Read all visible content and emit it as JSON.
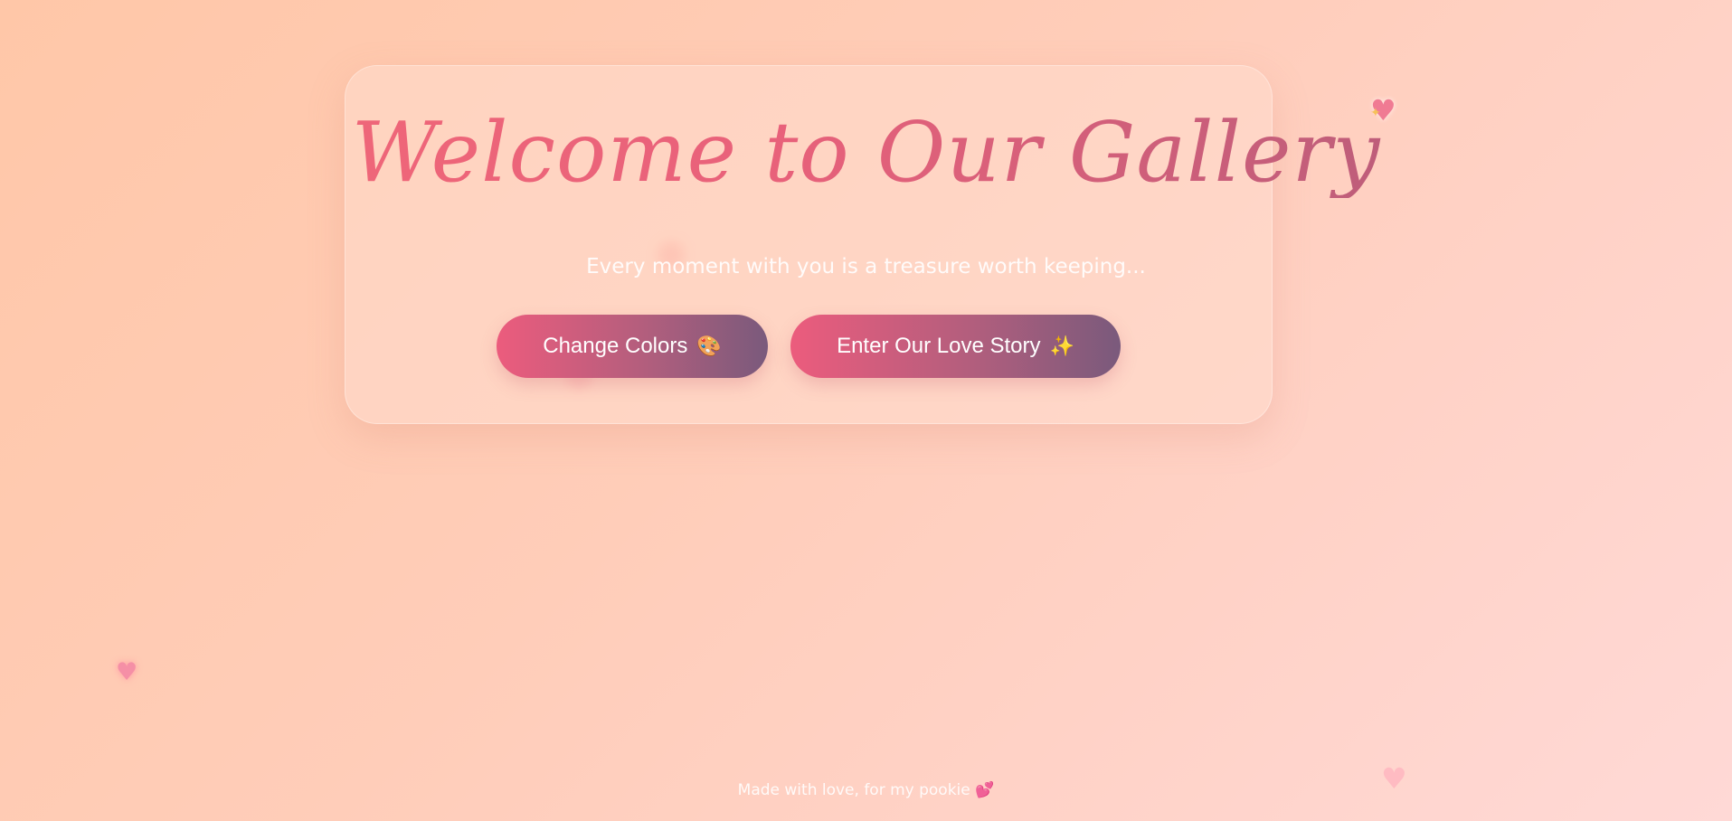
{
  "page": {
    "title": "Welcome to Our Gallery",
    "subtitle": "Every moment with you is a treasure worth keeping..."
  },
  "buttons": {
    "change_colors": {
      "label": "Change Colors",
      "icon": "🎨",
      "icon_name": "palette-icon"
    },
    "enter_story": {
      "label": "Enter Our Love Story",
      "icon": "✨",
      "icon_name": "sparkles-icon"
    }
  },
  "footer": {
    "text": "Made with love, for my pookie",
    "icon": "💕",
    "icon_name": "two-hearts-icon"
  },
  "decorations": {
    "floating_heart_icon": "♥",
    "sparkle_icon": "✦"
  },
  "colors": {
    "background_start": "#ffc7a8",
    "background_end": "#ffd9d6",
    "title_gradient_start": "#f46a78",
    "title_gradient_end": "#a65b7a",
    "button_gradient_start": "#ec5c7d",
    "button_gradient_end": "#7a5a7c"
  }
}
